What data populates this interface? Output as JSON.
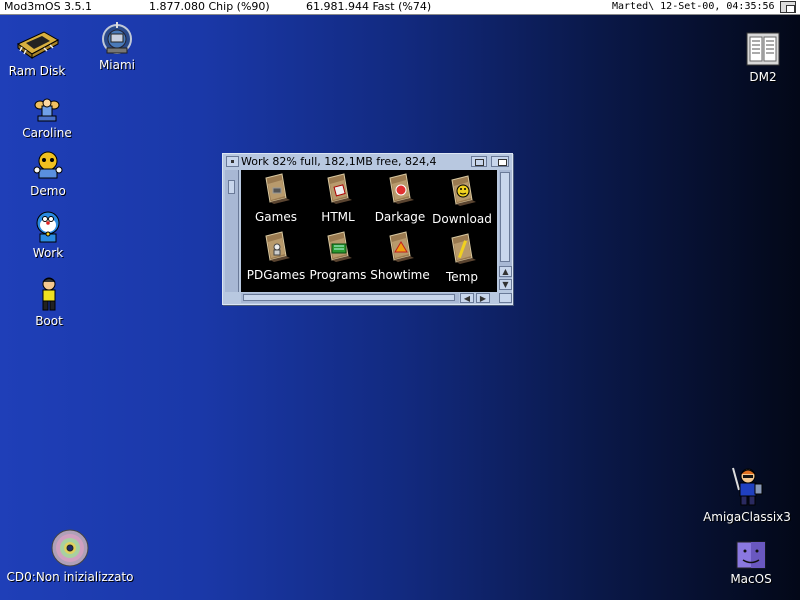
{
  "menubar": {
    "os_name": "Mod3mOS 3.5.1",
    "chip_mem": "1.877.080 Chip (%90)",
    "fast_mem": "61.981.944 Fast (%74)",
    "datetime": "Marted\\ 12-Set-00, 04:35:56"
  },
  "desktop_icons": {
    "ram_disk": "Ram Disk",
    "miami": "Miami",
    "caroline": "Caroline",
    "demo": "Demo",
    "work": "Work",
    "boot": "Boot",
    "dm2": "DM2",
    "cd0": "CD0:Non inizializzato",
    "amigaclassix": "AmigaClassix3",
    "macos": "MacOS"
  },
  "window": {
    "title": "Work  82% full, 182,1MB free, 824,4",
    "drawers": [
      "Games",
      "HTML",
      "Darkage",
      "Download",
      "PDGames",
      "Programs",
      "Showtime",
      "Temp"
    ]
  },
  "colors": {
    "desktop_gradient_start": "#1f3fb8",
    "desktop_gradient_end": "#030818",
    "window_frame": "#b8c8e0",
    "window_content": "#000000"
  }
}
